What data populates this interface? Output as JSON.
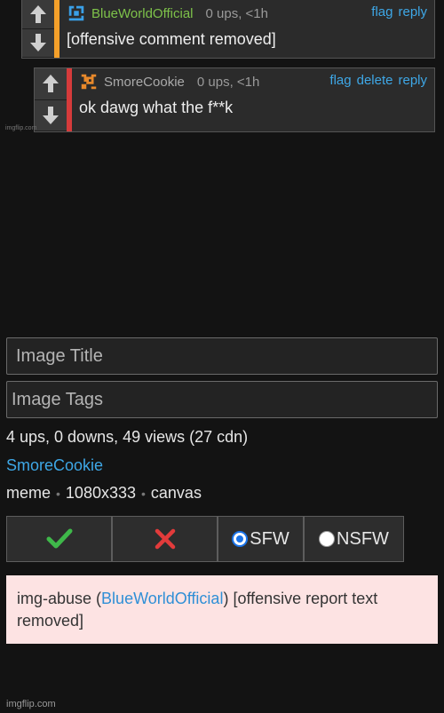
{
  "comments": [
    {
      "username": "BlueWorldOfficial",
      "meta": "0 ups, <1h",
      "actions": [
        "flag",
        "reply"
      ],
      "text": "[offensive comment removed]"
    },
    {
      "username": "SmoreCookie",
      "meta": "0 ups, <1h",
      "actions": [
        "flag",
        "delete",
        "reply"
      ],
      "text": "ok dawg what the f**k"
    }
  ],
  "watermark_small": "imgflip.com",
  "form": {
    "title_placeholder": "Image Title",
    "tags_placeholder": "Image Tags"
  },
  "stats": "4 ups, 0 downs, 49 views (27 cdn)",
  "author": "SmoreCookie",
  "info": {
    "type": "meme",
    "size": "1080x333",
    "source": "canvas"
  },
  "moderation": {
    "approve_icon": "check-icon",
    "reject_icon": "x-icon",
    "sfw_label": "SFW",
    "nsfw_label": "NSFW",
    "selected": "SFW"
  },
  "report": {
    "prefix": "img-abuse (",
    "user": "BlueWorldOfficial",
    "suffix": ")",
    "message": "[offensive report text removed]"
  },
  "watermark": "imgflip.com",
  "colors": {
    "link": "#3ea7e6",
    "user_green": "#7ec24a",
    "stripe_orange": "#f5a02a",
    "stripe_red": "#d63b3b",
    "report_bg": "#fde3e3"
  }
}
